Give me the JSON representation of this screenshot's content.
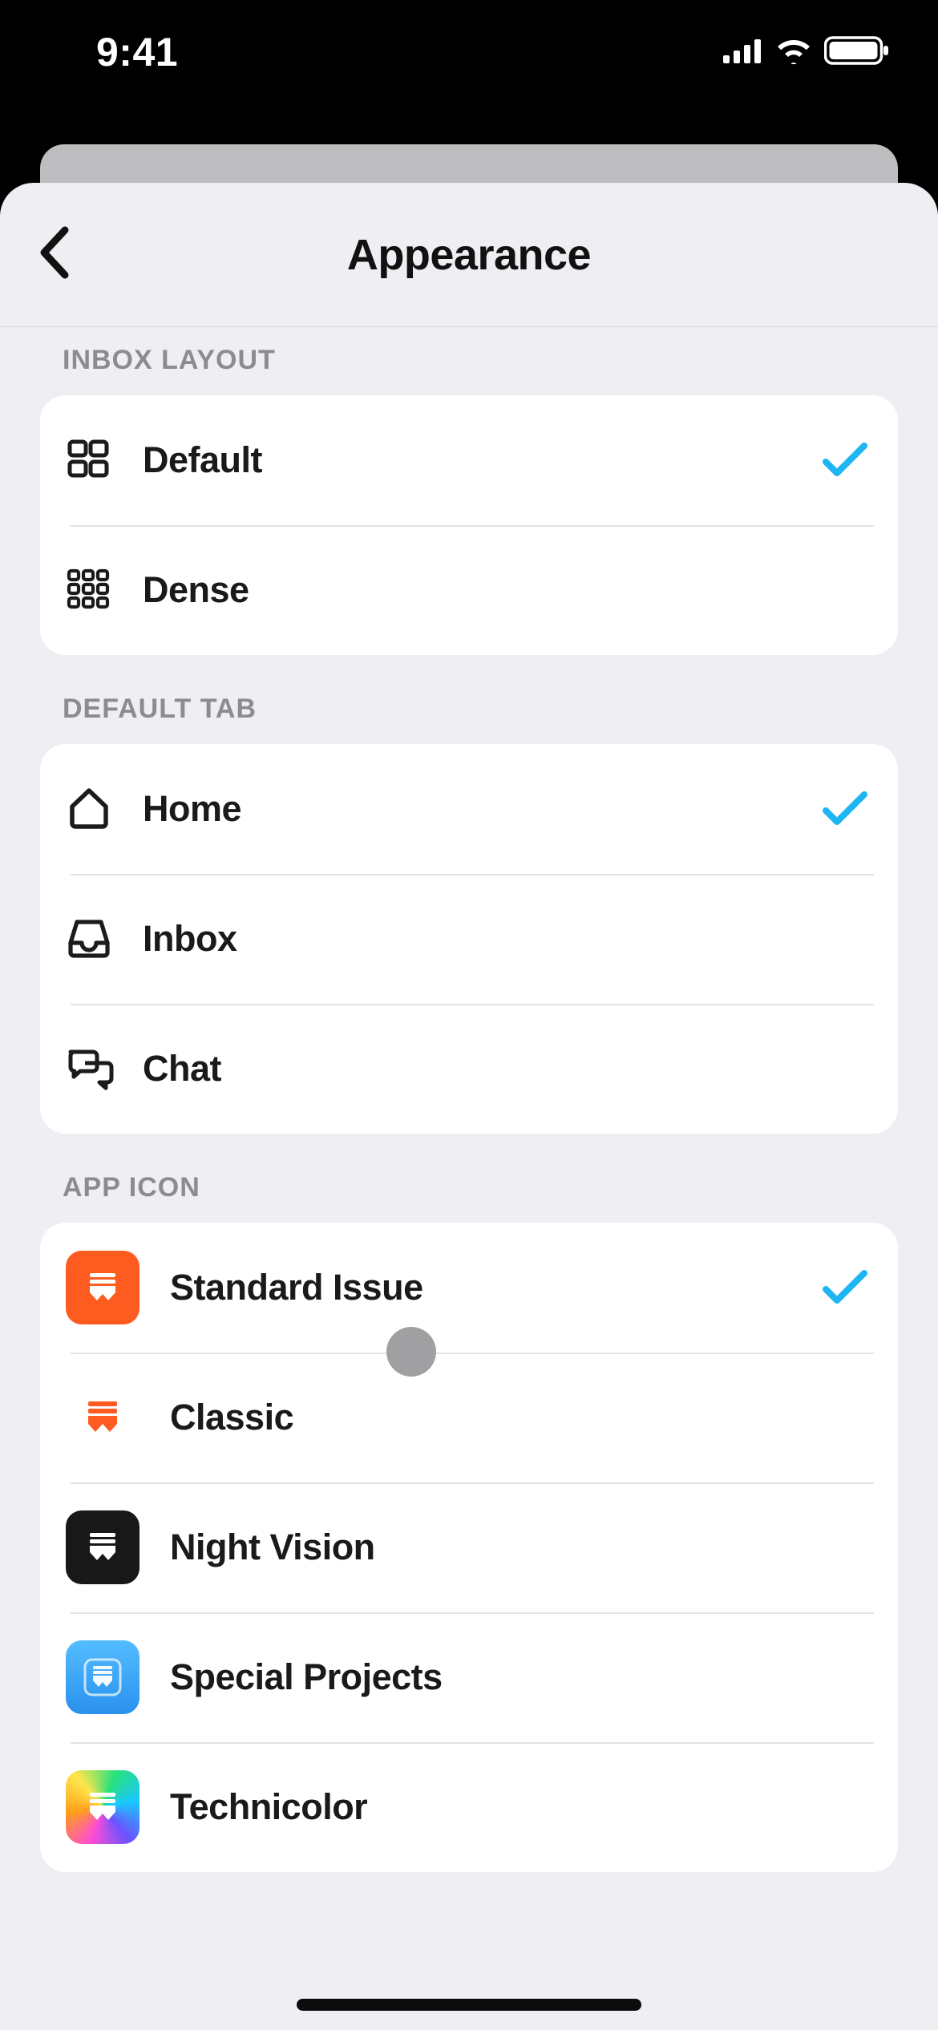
{
  "statusbar": {
    "time": "9:41"
  },
  "nav": {
    "title": "Appearance"
  },
  "sections": {
    "inbox_layout": {
      "header": "Inbox Layout",
      "items": [
        {
          "label": "Default",
          "selected": true
        },
        {
          "label": "Dense",
          "selected": false
        }
      ]
    },
    "default_tab": {
      "header": "Default Tab",
      "items": [
        {
          "label": "Home",
          "selected": true
        },
        {
          "label": "Inbox",
          "selected": false
        },
        {
          "label": "Chat",
          "selected": false
        }
      ]
    },
    "app_icon": {
      "header": "App Icon",
      "items": [
        {
          "label": "Standard Issue",
          "selected": true
        },
        {
          "label": "Classic",
          "selected": false
        },
        {
          "label": "Night Vision",
          "selected": false
        },
        {
          "label": "Special Projects",
          "selected": false
        },
        {
          "label": "Technicolor",
          "selected": false
        }
      ]
    }
  }
}
